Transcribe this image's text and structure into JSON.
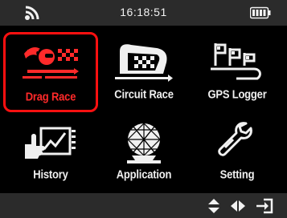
{
  "status_bar": {
    "time": "16:18:51",
    "signal_icon": "wifi-icon",
    "battery_icon": "battery-full-icon"
  },
  "menu": {
    "items": [
      {
        "label": "Drag Race",
        "icon": "drag-race-icon",
        "selected": true
      },
      {
        "label": "Circuit Race",
        "icon": "circuit-race-icon",
        "selected": false
      },
      {
        "label": "GPS Logger",
        "icon": "gps-logger-icon",
        "selected": false
      },
      {
        "label": "History",
        "icon": "history-icon",
        "selected": false
      },
      {
        "label": "Application",
        "icon": "application-icon",
        "selected": false
      },
      {
        "label": "Setting",
        "icon": "wrench-icon",
        "selected": false
      }
    ]
  },
  "bottom_bar": {
    "icons": [
      "up-down-arrows-icon",
      "left-right-arrows-icon",
      "exit-icon"
    ]
  },
  "colors": {
    "background": "#000000",
    "bar": "#2b2b2b",
    "selection": "#ff1010",
    "text": "#f0f0f0"
  }
}
